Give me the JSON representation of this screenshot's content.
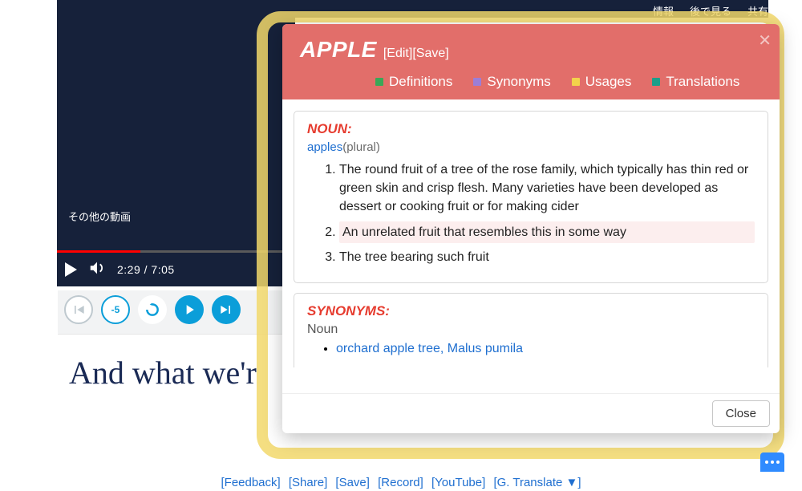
{
  "video": {
    "top_links": {
      "info": "情報",
      "watch_later": "後で見る",
      "share": "共有"
    },
    "more_videos_label": "その他の動画",
    "time_current": "2:29",
    "time_total": "7:05"
  },
  "round_controls": {
    "prev": "prev-track",
    "back5": "-5",
    "replay": "replay",
    "play": "play",
    "next": "next-track"
  },
  "subtitle": {
    "text": "And what we'r"
  },
  "dict": {
    "word": "APPLE",
    "edit_label": "[Edit]",
    "save_label": "[Save]",
    "tabs": {
      "definitions": "Definitions",
      "synonyms": "Synonyms",
      "usages": "Usages",
      "translations": "Translations"
    },
    "sections": {
      "noun_label": "NOUN:",
      "plural_word": "apples",
      "plural_note": "(plural)",
      "definitions": [
        "The round fruit of a tree of the rose family, which typically has thin red or green skin and crisp flesh. Many varieties have been developed as dessert or cooking fruit or for making cider",
        "An unrelated fruit that resembles this in some way",
        "The tree bearing such fruit"
      ],
      "synonyms_label": "SYNONYMS:",
      "syn_pos_label": "Noun",
      "synonyms": "orchard apple tree, Malus pumila"
    },
    "close_label": "Close"
  },
  "bottom_links": {
    "feedback": "[Feedback]",
    "share": "[Share]",
    "save": "[Save]",
    "record": "[Record]",
    "youtube": "[YouTube]",
    "gtranslate": "[G. Translate  ▼]"
  }
}
